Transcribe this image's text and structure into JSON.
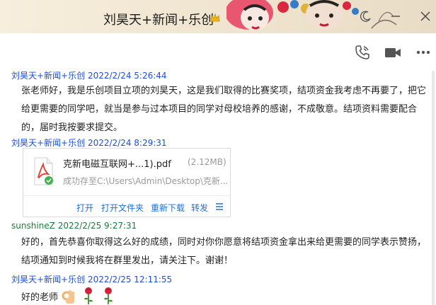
{
  "window": {
    "title": "刘昊天+新闻+乐创"
  },
  "messages": [
    {
      "sender": "刘昊天+新闻+乐创",
      "time": "2022/2/24 5:26:44",
      "text": "张老师好，我是乐创项目立项的刘昊天，这是我们取得的比赛奖项，结项资金我考虑不再要了，把它给更需要的同学吧，就当是参与过本项目的同学对母校培养的感谢，不成敬意。结项资料需要配合的，届时我按要求提交。"
    },
    {
      "sender": "刘昊天+新闻+乐创",
      "time": "2022/2/24 8:29:31",
      "file": {
        "name": "克新电磁互联网+...1).pdf",
        "size": "(2.12MB)",
        "status": "成功存至C:\\Users\\Admin\\Desktop\\克新...",
        "actions": [
          "打开",
          "打开文件夹",
          "重新下载",
          "转发"
        ]
      }
    },
    {
      "sender": "sunshineZ",
      "time": "2022/2/25 9:27:31",
      "text": "好的，首先恭喜你取得这么好的成绩，同时对你你愿意将结项资金拿出来给更需要的同学表示赞扬，结项通知到时候我将在群里发出，请关注下。谢谢！"
    },
    {
      "sender": "刘昊天+新闻+乐创",
      "time": "2022/2/25 12:11:55",
      "text": "好的老师"
    }
  ],
  "icons": {
    "toolbar": [
      "phone-icon",
      "video-icon",
      "more-icon"
    ],
    "emoji": [
      "ok-hand-icon",
      "rose-icon",
      "rose-icon"
    ]
  },
  "colors": {
    "sender_blue": "#1f4ed8",
    "sender_green": "#1d7a3a",
    "link_blue": "#1f6fd6",
    "title_bg": "#f7eedd"
  }
}
